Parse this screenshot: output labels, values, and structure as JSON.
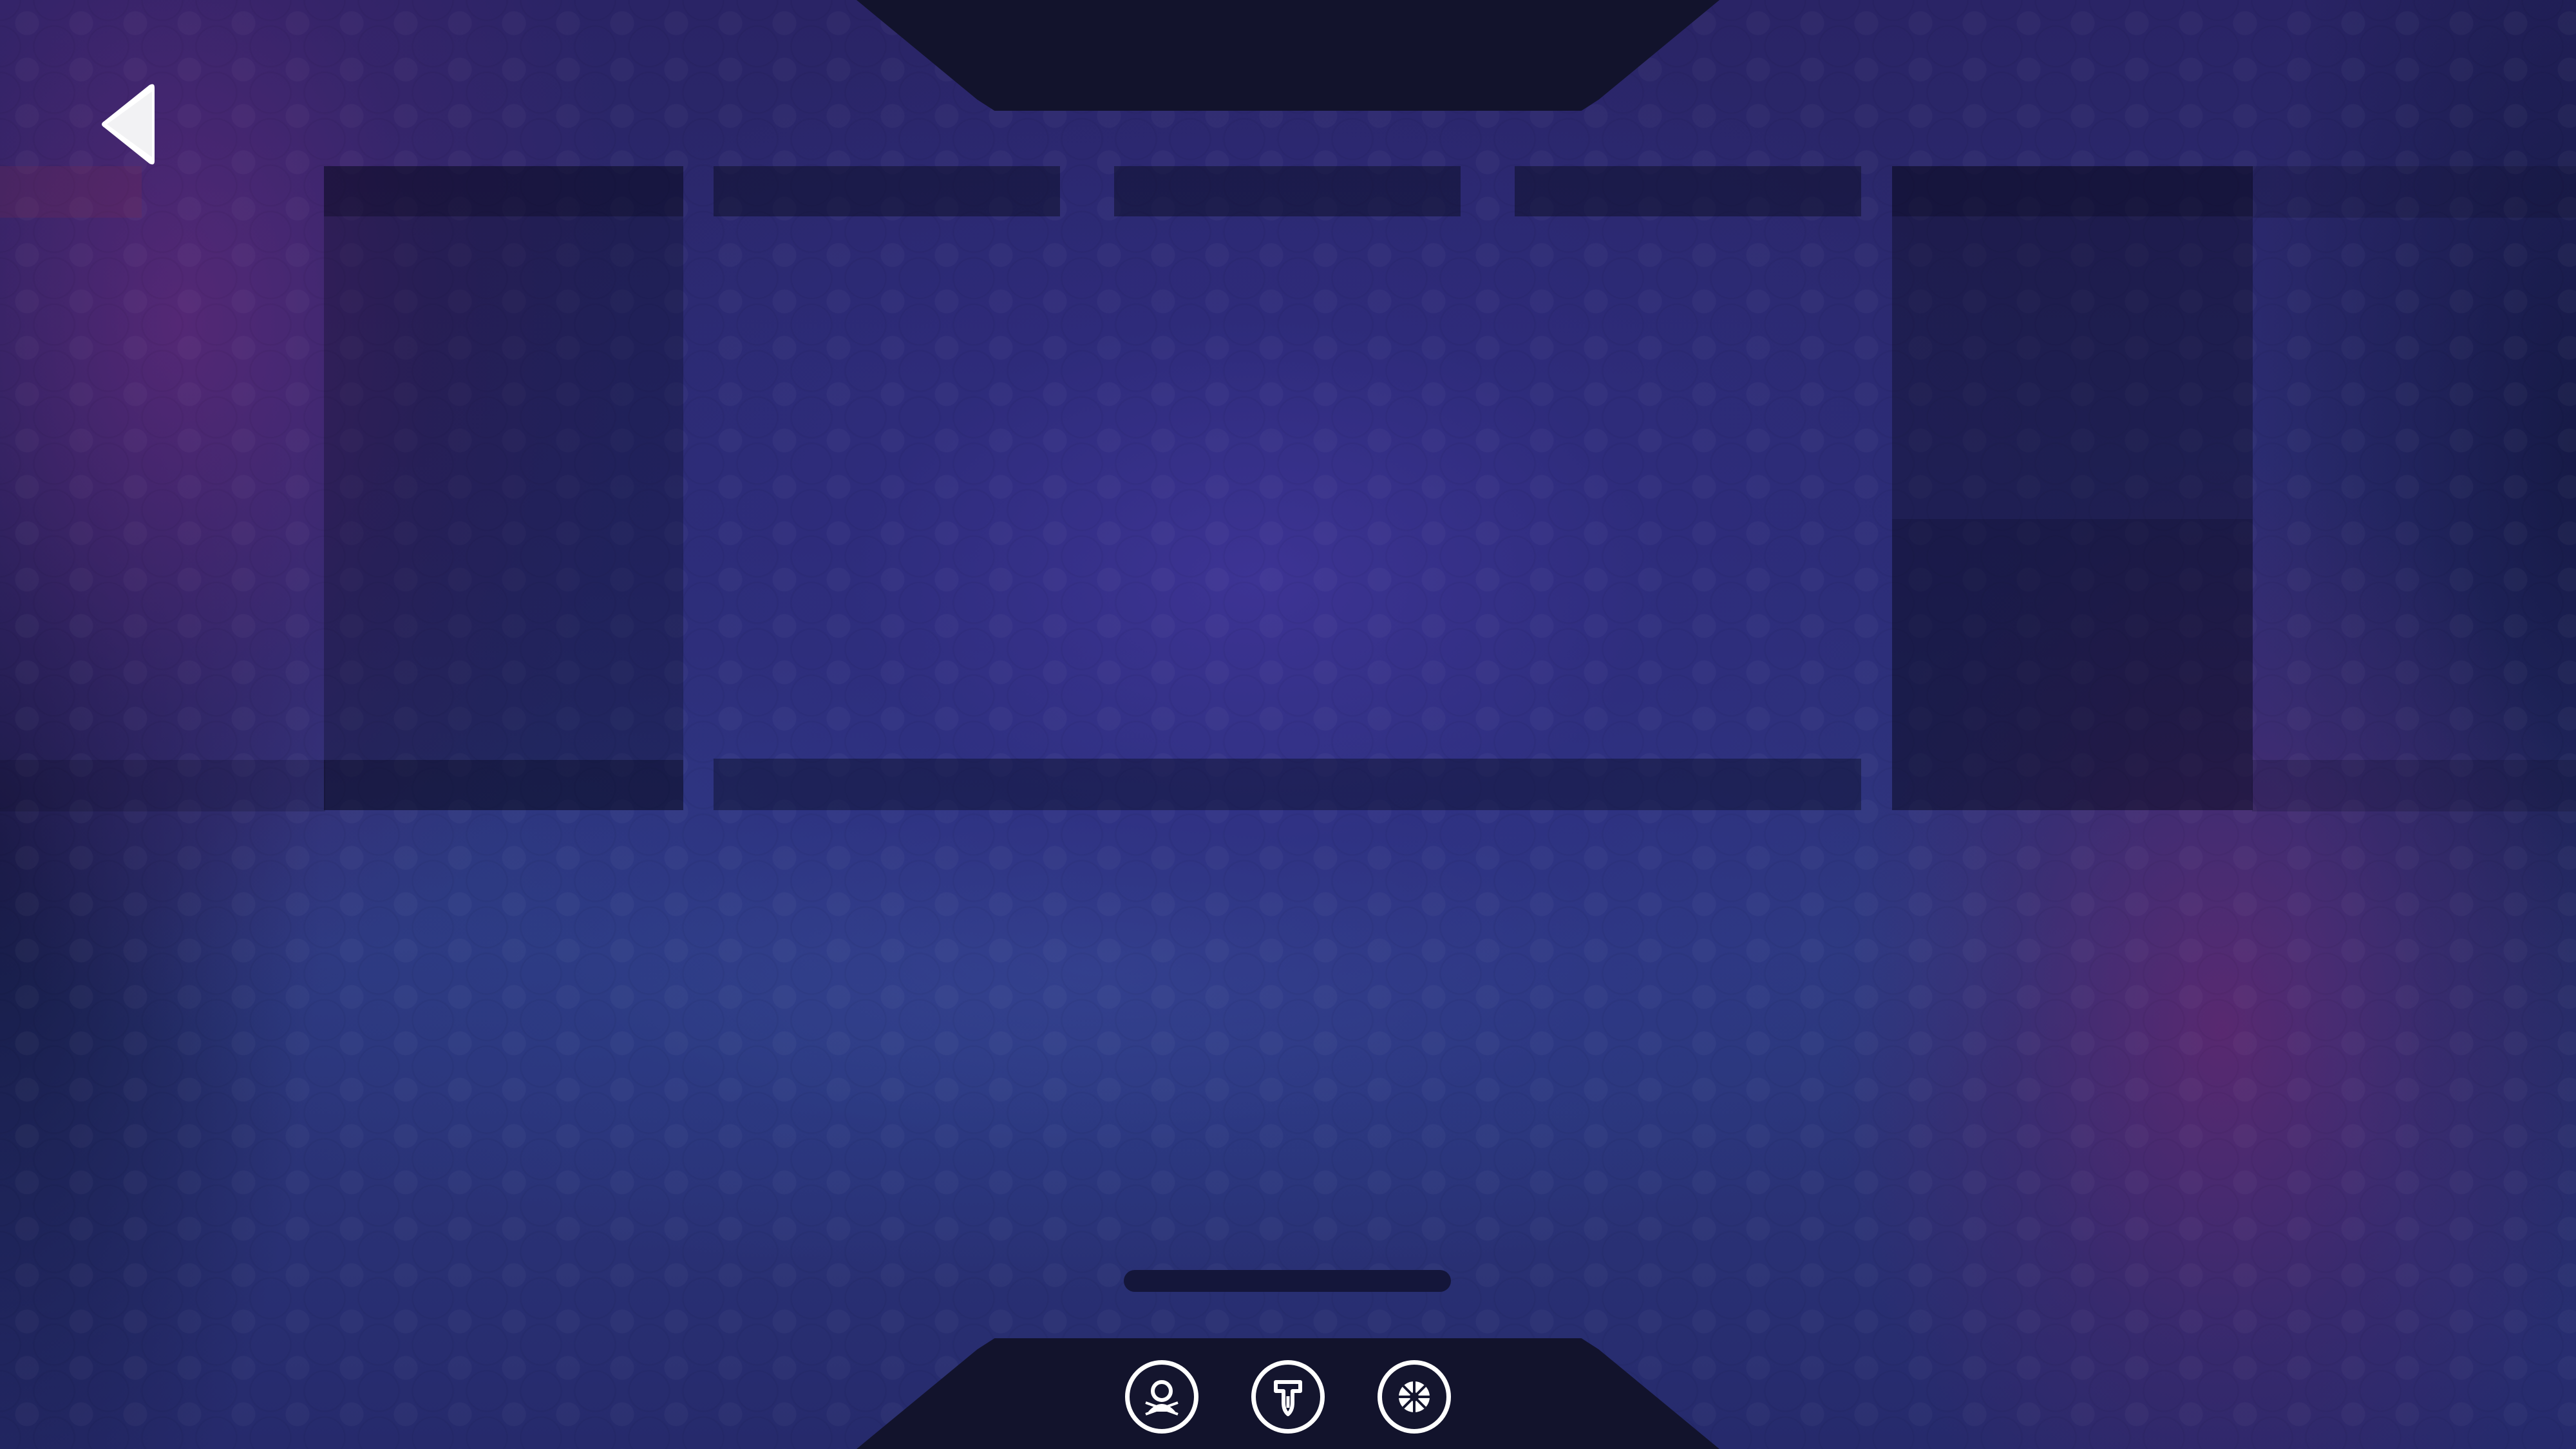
{
  "screen": {
    "title": "",
    "theme_colors": {
      "background_primary": "#26286a",
      "background_accent_purple": "#5c2878",
      "panel_dark": "#0a0c22",
      "dock": "#12132c",
      "icon_stroke": "#ffffff"
    }
  },
  "navigation": {
    "back_icon": "triangle-left-back-icon"
  },
  "dock": {
    "items": [
      {
        "icon": "character-helmet-icon"
      },
      {
        "icon": "skill-tree-icon"
      },
      {
        "icon": "settings-wheel-icon"
      }
    ]
  }
}
